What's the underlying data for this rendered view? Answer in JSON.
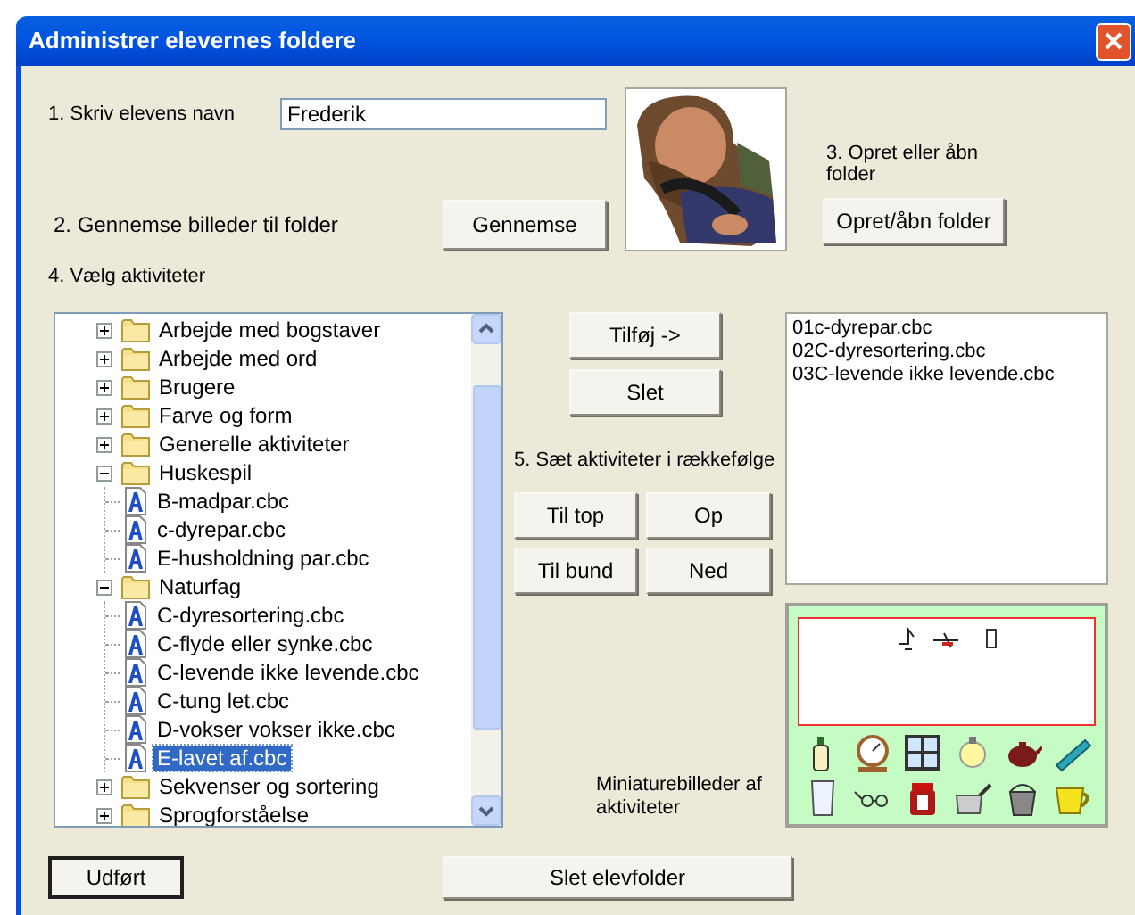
{
  "window": {
    "title": "Administrer elevernes foldere"
  },
  "step1": {
    "label": "1. Skriv elevens navn",
    "value": "Frederik"
  },
  "step2": {
    "label": "2. Gennemse billeder til folder",
    "button": "Gennemse"
  },
  "step3": {
    "label": "3. Opret eller åbn folder",
    "button": "Opret/åbn folder"
  },
  "step4": {
    "label": "4. Vælg aktiviteter"
  },
  "tree": [
    {
      "label": "Arbejde med bogstaver",
      "expanded": false,
      "selected": false
    },
    {
      "label": "Arbejde med ord",
      "expanded": false,
      "selected": false
    },
    {
      "label": "Brugere",
      "expanded": false,
      "selected": false
    },
    {
      "label": "Farve og form",
      "expanded": false,
      "selected": false
    },
    {
      "label": "Generelle aktiviteter",
      "expanded": false,
      "selected": false
    },
    {
      "label": "Huskespil",
      "expanded": true,
      "selected": false,
      "children": [
        {
          "label": "B-madpar.cbc",
          "selected": false
        },
        {
          "label": "c-dyrepar.cbc",
          "selected": false
        },
        {
          "label": "E-husholdning par.cbc",
          "selected": false
        }
      ]
    },
    {
      "label": "Naturfag",
      "expanded": true,
      "selected": false,
      "children": [
        {
          "label": "C-dyresortering.cbc",
          "selected": false
        },
        {
          "label": "C-flyde eller synke.cbc",
          "selected": false
        },
        {
          "label": "C-levende ikke levende.cbc",
          "selected": false
        },
        {
          "label": "C-tung let.cbc",
          "selected": false
        },
        {
          "label": "D-vokser vokser ikke.cbc",
          "selected": false
        },
        {
          "label": "E-lavet af.cbc",
          "selected": true
        }
      ]
    },
    {
      "label": "Sekvenser og sortering",
      "expanded": false,
      "selected": false
    },
    {
      "label": "Sprogforståelse",
      "expanded": false,
      "selected": false
    }
  ],
  "add_button": "Tilføj ->",
  "delete_button": "Slet",
  "step5": {
    "label": "5. Sæt aktiviteter i rækkefølge",
    "buttons": [
      "Til top",
      "Op",
      "Til bund",
      "Ned"
    ]
  },
  "chosen": [
    "01c-dyrepar.cbc",
    "02C-dyresortering.cbc",
    "03C-levende ikke levende.cbc"
  ],
  "thumbnails_label": "Miniaturebilleder af aktiviteter",
  "footer": {
    "done": "Udført",
    "delete_folder": "Slet elevfolder"
  }
}
